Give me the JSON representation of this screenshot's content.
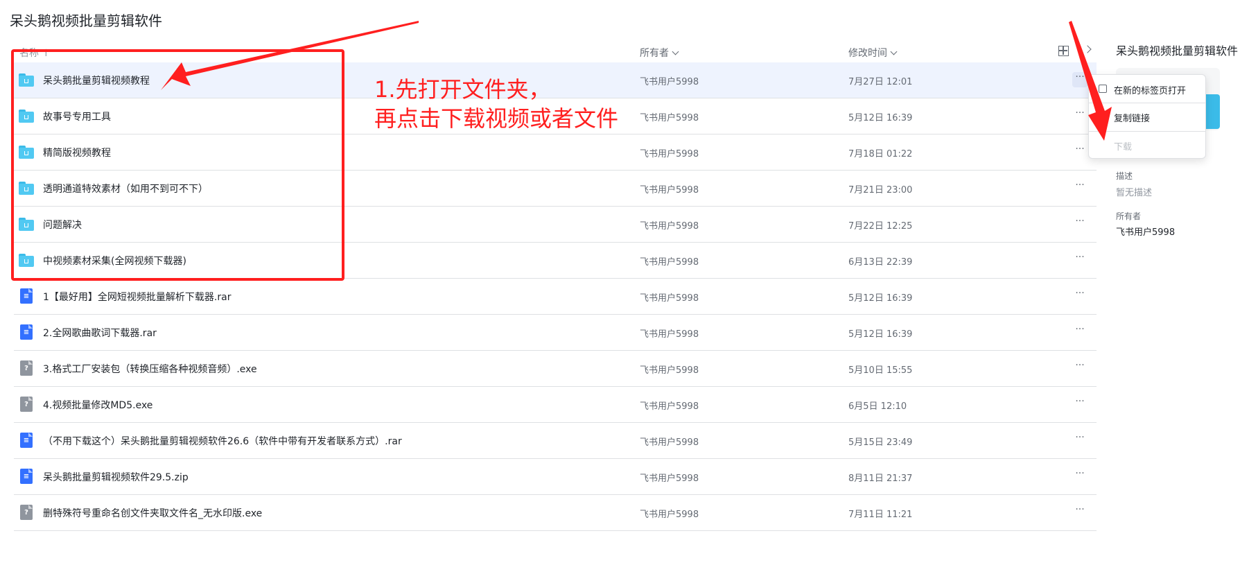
{
  "page": {
    "title": "呆头鹅视频批量剪辑软件"
  },
  "list": {
    "header": {
      "name": "名称 ↑",
      "owner": "所有者",
      "modified": "修改时间"
    },
    "rows": [
      {
        "type": "folder",
        "name": "呆头鹅批量剪辑视频教程",
        "owner": "飞书用户5998",
        "modified": "7月27日 12:01",
        "more": "···",
        "selected": true
      },
      {
        "type": "folder",
        "name": "故事号专用工具",
        "owner": "飞书用户5998",
        "modified": "5月12日 16:39",
        "more": "···"
      },
      {
        "type": "folder",
        "name": "精简版视频教程",
        "owner": "飞书用户5998",
        "modified": "7月18日 01:22",
        "more": "···"
      },
      {
        "type": "folder",
        "name": "透明通道特效素材（如用不到可不下）",
        "owner": "飞书用户5998",
        "modified": "7月21日 23:00",
        "more": "···"
      },
      {
        "type": "folder",
        "name": "问题解决",
        "owner": "飞书用户5998",
        "modified": "7月22日 12:25",
        "more": "···"
      },
      {
        "type": "folder",
        "name": "中视频素材采集(全网视频下载器)",
        "owner": "飞书用户5998",
        "modified": "6月13日 22:39",
        "more": "···"
      },
      {
        "type": "rar",
        "name": "1【最好用】全网短视频批量解析下载器.rar",
        "owner": "飞书用户5998",
        "modified": "5月12日 16:39",
        "more": "···"
      },
      {
        "type": "rar",
        "name": "2.全网歌曲歌词下载器.rar",
        "owner": "飞书用户5998",
        "modified": "5月12日 16:39",
        "more": "···"
      },
      {
        "type": "exe",
        "name": "3.格式工厂安装包（转换压缩各种视频音频）.exe",
        "owner": "飞书用户5998",
        "modified": "5月10日 15:55",
        "more": "···"
      },
      {
        "type": "exe",
        "name": "4.视频批量修改MD5.exe",
        "owner": "飞书用户5998",
        "modified": "6月5日 12:10",
        "more": "···"
      },
      {
        "type": "rar",
        "name": "（不用下载这个）呆头鹅批量剪辑视频软件26.6（软件中带有开发者联系方式）.rar",
        "owner": "飞书用户5998",
        "modified": "5月15日 23:49",
        "more": "···"
      },
      {
        "type": "zip",
        "name": "呆头鹅批量剪辑视频软件29.5.zip",
        "owner": "飞书用户5998",
        "modified": "8月11日 21:37",
        "more": "···"
      },
      {
        "type": "exe",
        "name": "删特殊符号重命名创文件夹取文件名_无水印版.exe",
        "owner": "飞书用户5998",
        "modified": "7月11日 11:21",
        "more": "···"
      }
    ]
  },
  "side_panel": {
    "title": "呆头鹅视频批量剪辑软件",
    "description_label": "描述",
    "description_value": "暂无描述",
    "owner_label": "所有者",
    "owner_value": "飞书用户5998"
  },
  "context_menu": {
    "open_new_tab": "在新的标签页打开",
    "copy_link": "复制链接",
    "download": "下载"
  },
  "annotation": {
    "line1": "1.先打开文件夹，",
    "line2": "再点击下载视频或者文件",
    "color": "#ff1f1f"
  },
  "file_icon_marks": {
    "rar": "≡",
    "zip": "≡",
    "exe": "?"
  },
  "colors": {
    "folder": "#51c9f2",
    "rar": "#3370ff",
    "exe": "#8f959e",
    "selected_row": "#eef3fe"
  }
}
